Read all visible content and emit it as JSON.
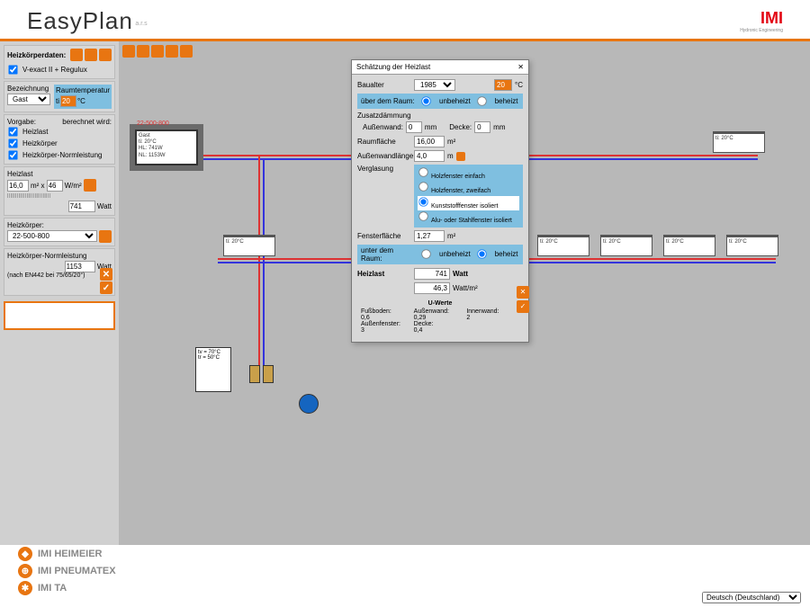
{
  "app": {
    "title": "EasyPlan",
    "version": "a.r.s",
    "logo": "IMI",
    "logo_sub": "Hydronic Engineering"
  },
  "sidebar": {
    "heading": "Heizkörperdaten:",
    "valve": "V-exact II + Regulux",
    "bez_lbl": "Bezeichnung",
    "bez_val": "Gast",
    "raumtemp_lbl": "Raumtemperatur",
    "raumtemp_ti": "ti",
    "raumtemp_val": "20",
    "raumtemp_unit": "°C",
    "vorgabe_lbl": "Vorgabe:",
    "berechnet_lbl": "berechnet wird:",
    "ck_heizlast": "Heizlast",
    "ck_heizkoerper": "Heizkörper",
    "ck_norm": "Heizkörper-Normleistung",
    "heizlast_lbl": "Heizlast",
    "heizlast_area": "16,0",
    "heizlast_area_unit": "m² x",
    "heizlast_wm2": "46",
    "heizlast_wm2_unit": "W/m²",
    "heizlast_watt": "741",
    "heizlast_watt_unit": "Watt",
    "hk_lbl": "Heizkörper:",
    "hk_val": "22-500-800",
    "norm_lbl": "Heizkörper-Normleistung",
    "norm_val": "1153",
    "norm_unit": "Watt",
    "norm_note": "(nach EN442 bei 75/65/20°)"
  },
  "selected_radiator": {
    "title": "22-500-800",
    "l1": "Gast",
    "l2": "ti: 20°C",
    "l3": "HL: 741W",
    "l4": "NL: 1153W"
  },
  "radiator_label": "ti: 20°C",
  "boiler": {
    "tv": "tv = 70°C",
    "tr": "tr = 50°C"
  },
  "dialog": {
    "title": "Schätzung der Heizlast",
    "baualter_lbl": "Baualter",
    "baualter_val": "1985",
    "temp_val": "20",
    "temp_unit": "°C",
    "ueber_lbl": "über dem Raum:",
    "unbeheizt": "unbeheizt",
    "beheizt": "beheizt",
    "zusatz_lbl": "Zusatzdämmung",
    "aussenwand_lbl": "Außenwand:",
    "aussenwand_val": "0",
    "mm": "mm",
    "decke_lbl": "Decke:",
    "decke_val": "0",
    "raumflaeche_lbl": "Raumfläche",
    "raumflaeche_val": "16,00",
    "m2": "m²",
    "aussenwandlg_lbl": "Außenwandlänge",
    "aussenwandlg_val": "4,0",
    "m": "m",
    "verglasung_lbl": "Verglasung",
    "verg1": "Holzfenster einfach",
    "verg2": "Holzfenster, zweifach",
    "verg3": "Kunststofffenster isoliert",
    "verg4": "Alu- oder Stahlfenster isoliert",
    "fensterfl_lbl": "Fensterfläche",
    "fensterfl_val": "1,27",
    "unter_lbl": "unter dem Raum:",
    "heizlast_lbl": "Heizlast",
    "heizlast_val": "741",
    "heizlast_watt": "Watt",
    "heizlast_wm2": "46,3",
    "wm2_unit": "Watt/m²",
    "uwerte_hd": "U-Werte",
    "u_fb_lbl": "Fußboden:",
    "u_fb": "0,6",
    "u_aw_lbl": "Außenwand:",
    "u_aw": "0,29",
    "u_iw_lbl": "Innenwand:",
    "u_iw": "2",
    "u_af_lbl": "Außenfenster:",
    "u_af": "3",
    "u_de_lbl": "Decke:",
    "u_de": "0,4"
  },
  "footer": {
    "a": "IMI HEIMEIER",
    "b": "IMI PNEUMATEX",
    "c": "IMI TA"
  },
  "lang": "Deutsch (Deutschland)"
}
